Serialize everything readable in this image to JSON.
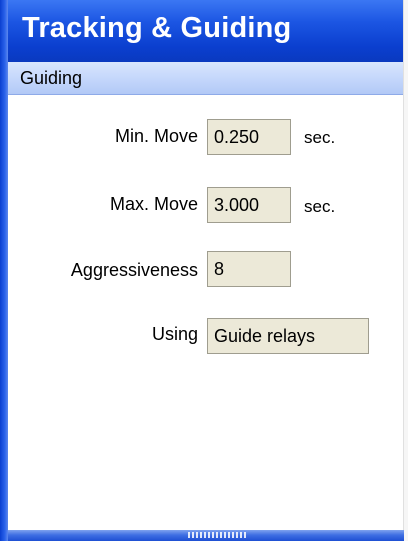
{
  "window": {
    "title": "Tracking & Guiding"
  },
  "section": {
    "title": "Guiding"
  },
  "fields": {
    "min_move": {
      "label": "Min. Move",
      "value": "0.250",
      "unit": "sec."
    },
    "max_move": {
      "label": "Max. Move",
      "value": "3.000",
      "unit": "sec."
    },
    "aggressiveness": {
      "label": "Aggressiveness",
      "value": "8"
    },
    "using": {
      "label": "Using",
      "value": "Guide relays"
    }
  },
  "colors": {
    "title_bar": "#1c56e3",
    "section_header": "#c3d6fb",
    "field_background": "#ece9d8"
  },
  "icons": {
    "resize_grip": "resize-grip-icon"
  }
}
